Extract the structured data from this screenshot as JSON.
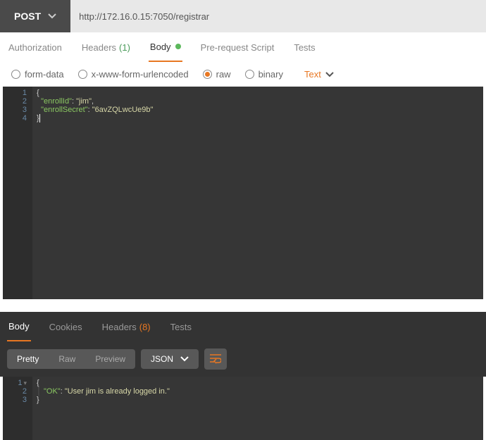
{
  "request": {
    "method": "POST",
    "url": "http://172.16.0.15:7050/registrar",
    "tabs": {
      "authorization": "Authorization",
      "headers": "Headers",
      "headers_count": "(1)",
      "body": "Body",
      "prerequest": "Pre-request Script",
      "tests": "Tests"
    },
    "body_type": {
      "form_data": "form-data",
      "urlencoded": "x-www-form-urlencoded",
      "raw": "raw",
      "binary": "binary",
      "text_dropdown": "Text"
    },
    "body_content": {
      "lines": [
        "1",
        "2",
        "3",
        "4"
      ],
      "json": {
        "enrollId": "jim",
        "enrollSecret": "6avZQLwcUe9b"
      },
      "raw_key1": "\"enrollId\"",
      "raw_val1": "\"jim\"",
      "raw_key2": "\"enrollSecret\"",
      "raw_val2": "\"6avZQLwcUe9b\""
    }
  },
  "response": {
    "tabs": {
      "body": "Body",
      "cookies": "Cookies",
      "headers": "Headers",
      "headers_count": "(8)",
      "tests": "Tests"
    },
    "view": {
      "pretty": "Pretty",
      "raw": "Raw",
      "preview": "Preview",
      "format": "JSON"
    },
    "content": {
      "lines": [
        "1",
        "2",
        "3"
      ],
      "json": {
        "OK": "User jim is already logged in."
      },
      "raw_key1": "\"OK\"",
      "raw_val1": "\"User jim is already logged in.\""
    }
  }
}
